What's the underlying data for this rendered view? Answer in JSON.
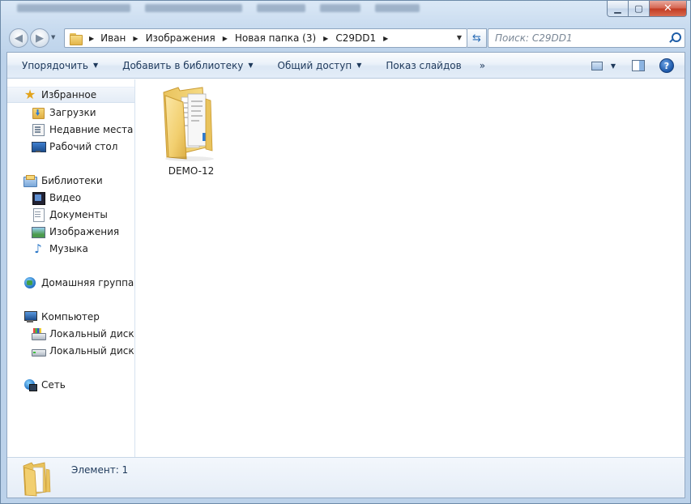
{
  "window": {
    "minimize_icon": "minimize-icon",
    "maximize_icon": "maximize-icon",
    "close_icon": "close-icon"
  },
  "navigation": {
    "breadcrumb": [
      "Иван",
      "Изображения",
      "Новая папка (3)",
      "C29DD1"
    ],
    "search_placeholder": "Поиск: C29DD1"
  },
  "toolbar": {
    "organize": "Упорядочить",
    "add_to_library": "Добавить в библиотеку",
    "share": "Общий доступ",
    "slideshow": "Показ слайдов",
    "more": "»"
  },
  "sidebar": {
    "favorites": "Избранное",
    "downloads": "Загрузки",
    "recent_places": "Недавние места",
    "desktop": "Рабочий стол",
    "libraries": "Библиотеки",
    "video": "Видео",
    "documents": "Документы",
    "images": "Изображения",
    "music": "Музыка",
    "homegroup": "Домашняя группа",
    "computer": "Компьютер",
    "drive_c": "Локальный диск (C",
    "drive_d": "Локальный диск (D",
    "network": "Сеть"
  },
  "content": {
    "items": [
      {
        "name": "DEMO-12",
        "type": "folder"
      }
    ]
  },
  "status": {
    "text": "Элемент: 1"
  },
  "colors": {
    "accent": "#1e395b",
    "folder": "#f2cf6f"
  }
}
